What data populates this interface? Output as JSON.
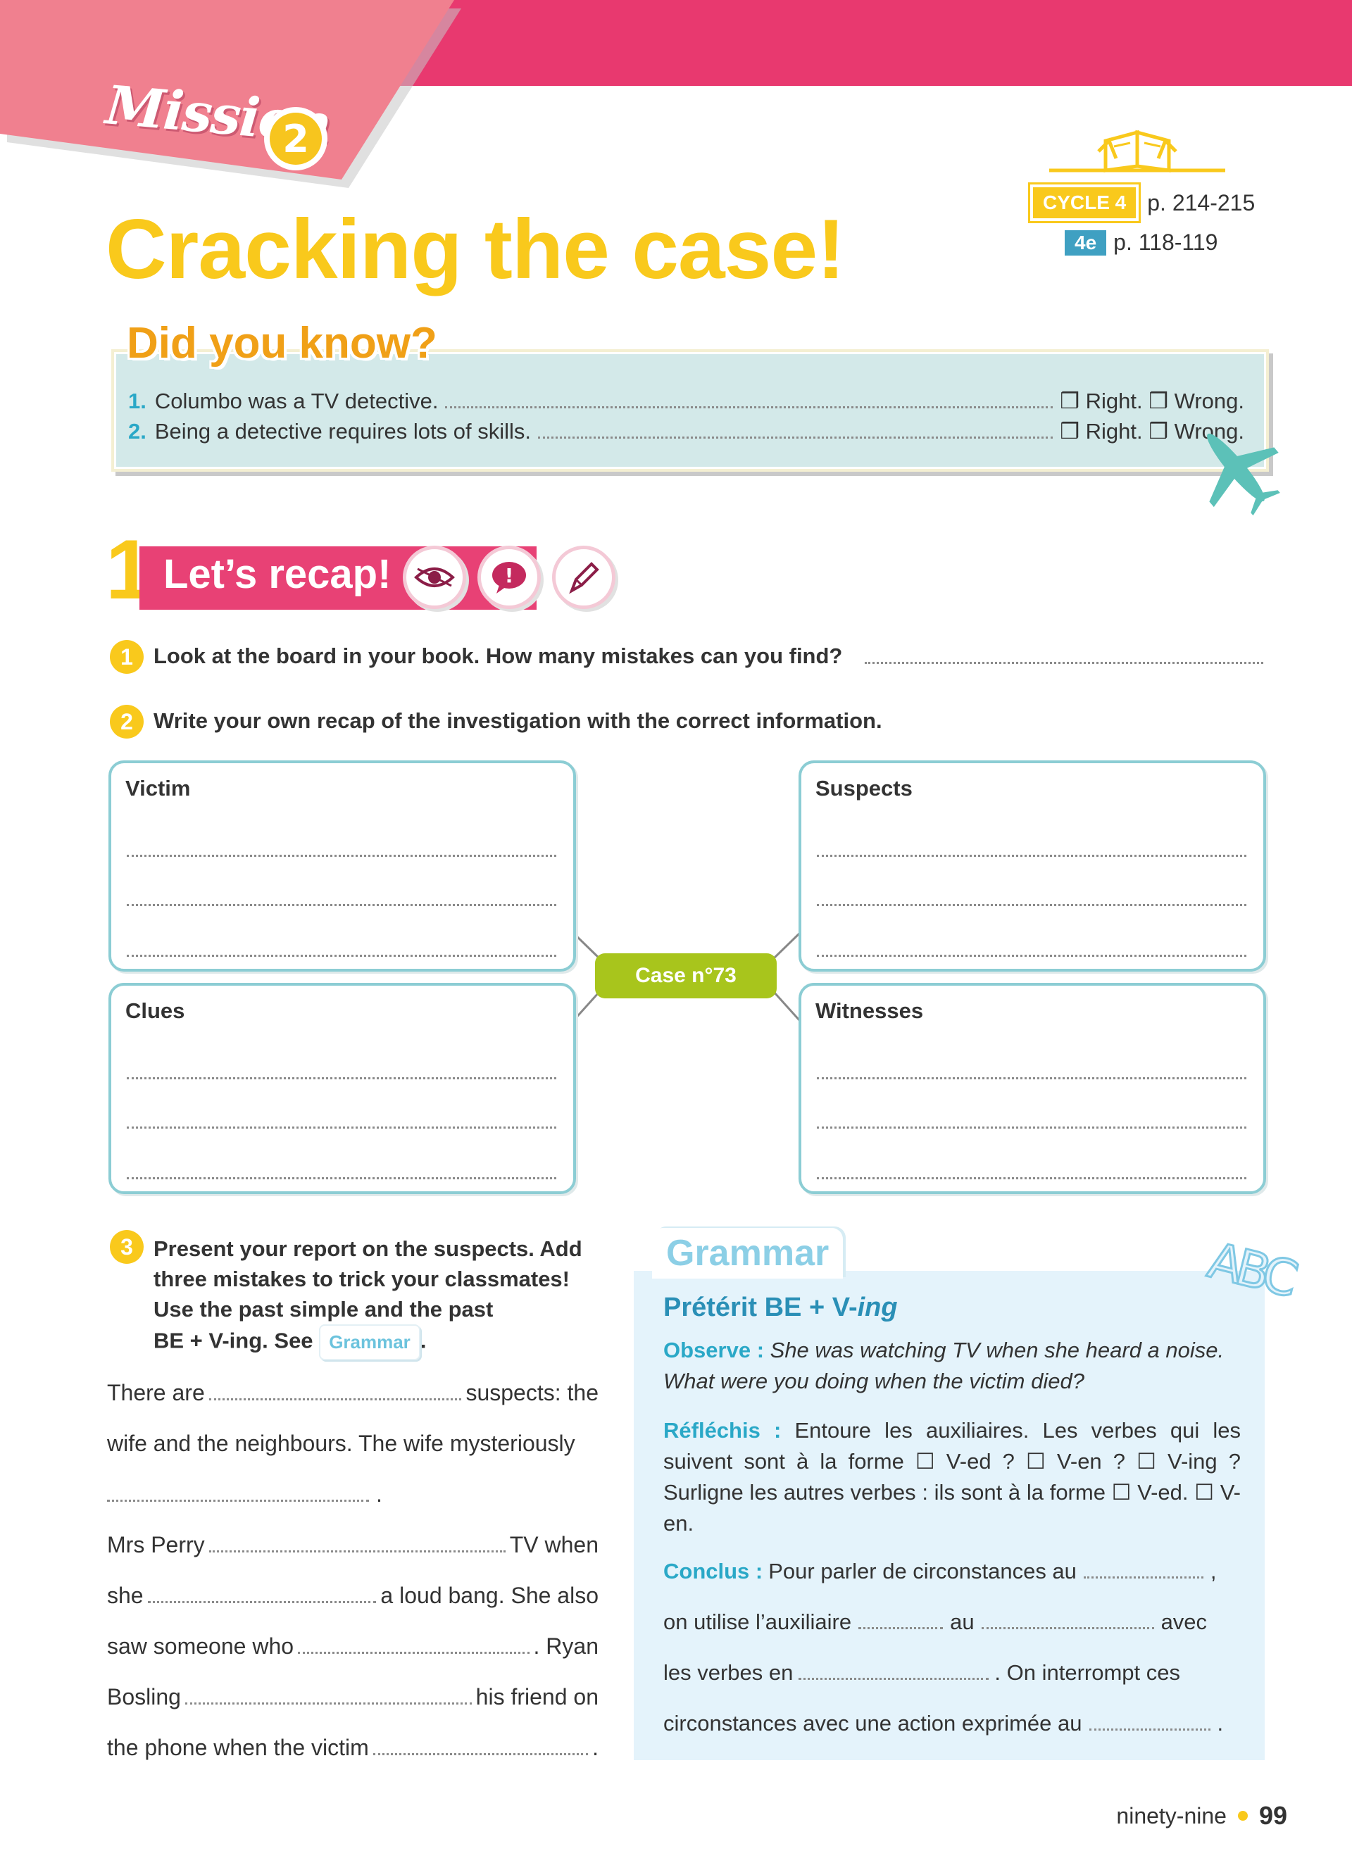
{
  "header": {
    "mission_label": "Mission",
    "mission_number": "2",
    "title": "Cracking the case!",
    "refs": {
      "cycle_badge": "CYCLE 4",
      "cycle_pages": "p. 214-215",
      "grade_badge": "4e",
      "grade_pages": "p. 118-119"
    }
  },
  "did_you_know": {
    "title": "Did you know?",
    "items": [
      {
        "num": "1.",
        "text": "Columbo was a TV detective.",
        "options": "❒ Right. ❒ Wrong."
      },
      {
        "num": "2.",
        "text": "Being a detective requires lots of skills.",
        "options": "❒ Right. ❒ Wrong."
      }
    ]
  },
  "section": {
    "number": "1",
    "title": "Let’s recap!",
    "icons": [
      "eye-icon",
      "exclamation-bubble-icon",
      "pen-icon"
    ]
  },
  "questions": {
    "q1": {
      "num": "1",
      "text": "Look at the board in your book. How many mistakes can you find?"
    },
    "q2": {
      "num": "2",
      "text": "Write your own recap of the investigation with the correct information."
    },
    "q3": {
      "num": "3",
      "lines": [
        "Present your report on the suspects. Add",
        "three mistakes to trick your classmates!",
        "Use the past simple and the past",
        "BE + V-ing. See"
      ],
      "tag": "Grammar",
      "end": "."
    }
  },
  "case_board": {
    "center": "Case n°73",
    "boxes": [
      "Victim",
      "Suspects",
      "Clues",
      "Witnesses"
    ]
  },
  "report": {
    "l1a": "There are",
    "l1b": "suspects: the",
    "l2": "wife and the neighbours. The wife mysteriously",
    "l3": ".",
    "l4a": "Mrs Perry",
    "l4b": "TV when",
    "l5a": "she",
    "l5b": "a loud bang. She also",
    "l6a": "saw someone who",
    "l6b": ". Ryan",
    "l7a": "Bosling",
    "l7b": "his friend on",
    "l8a": "the phone when the victim",
    "l8b": "."
  },
  "grammar": {
    "title": "Grammar",
    "sub_a": "Prétérit BE + V-",
    "sub_b": "ing",
    "observe_label": "Observe :",
    "observe_text": "She was watching TV when she heard a noise. What were you doing when the victim died?",
    "reflechis_label": "Réfléchis :",
    "reflechis_text": "Entoure les auxiliaires. Les verbes qui les suivent sont à la forme ☐ V-ed ? ☐ V-en ? ☐ V-ing ? Surligne les autres verbes : ils sont à la forme ☐ V-ed. ☐ V-en.",
    "conclus_label": "Conclus :",
    "c1": "Pour parler de circonstances au",
    "c1end": ",",
    "c2a": "on utilise l’auxiliaire",
    "c2b": "au",
    "c2c": "avec",
    "c3a": "les verbes en",
    "c3b": ". On interrompt ces",
    "c4a": "circonstances avec une action exprimée au",
    "c4b": ".",
    "abc": "ABC"
  },
  "footer": {
    "words": "ninety-nine",
    "number": "99"
  },
  "colors": {
    "pink": "#e84175",
    "yellow": "#f9c91c",
    "teal": "#8ccdd4",
    "green": "#a8c51c",
    "blue": "#2aa8c7"
  }
}
